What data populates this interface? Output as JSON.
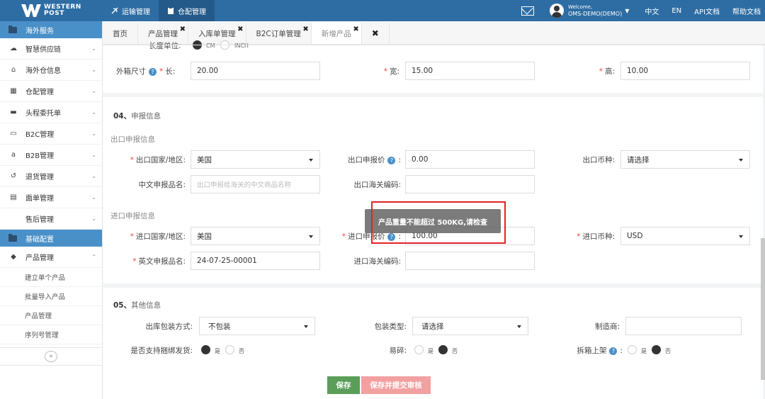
{
  "logo": {
    "line1": "WESTERN",
    "line2": "POST"
  },
  "topnav": [
    {
      "label": "运输管理",
      "icon": "plane-icon"
    },
    {
      "label": "仓配管理",
      "icon": "clipboard-icon"
    }
  ],
  "topright": {
    "welcome": "Welcome,",
    "user": "OMS-DEMO(DEMO)",
    "lang_zh": "中文",
    "lang_en": "EN",
    "api_docs": "API文档",
    "help_docs": "帮助文档"
  },
  "sidebar": {
    "section1": "海外服务",
    "items1": [
      {
        "label": "智慧供应链",
        "icon": "☁"
      },
      {
        "label": "海外仓信息",
        "icon": "⌂"
      },
      {
        "label": "仓配管理",
        "icon": "▦"
      },
      {
        "label": "头程委托单",
        "icon": "▬"
      },
      {
        "label": "B2C管理",
        "icon": "▭"
      },
      {
        "label": "B2B管理",
        "icon": "a"
      },
      {
        "label": "退货管理",
        "icon": "↺"
      },
      {
        "label": "面单管理",
        "icon": "▤"
      },
      {
        "label": "售后管理",
        "icon": ""
      }
    ],
    "section2": "基础配置",
    "product_mgmt": "产品管理",
    "subitems": [
      "建立单个产品",
      "批量导入产品",
      "产品管理",
      "序列号管理"
    ],
    "collapse": "«"
  },
  "tabs": [
    {
      "label": "首页",
      "closable": false
    },
    {
      "label": "产品管理",
      "closable": true
    },
    {
      "label": "入库单管理",
      "closable": true
    },
    {
      "label": "B2C订单管理",
      "closable": true
    },
    {
      "label": "新增产品",
      "closable": true
    }
  ],
  "form": {
    "unit": {
      "label": "长度单位:",
      "opt1": "CM",
      "opt2": "INCH"
    },
    "outer": {
      "label": "外箱尺寸",
      "length_label": "长:",
      "length": "20.00",
      "width_label": "宽:",
      "width": "15.00",
      "height_label": "高:",
      "height": "10.00"
    },
    "sec04": {
      "num": "04、",
      "title": "申报信息"
    },
    "export_title": "出口申报信息",
    "export": {
      "country_label": "出口国家/地区:",
      "country": "美国",
      "price_label": "出口申报价",
      "price": "0.00",
      "currency_label": "出口币种:",
      "currency": "请选择",
      "cn_name_label": "中文申报品名:",
      "cn_name_placeholder": "出口申报给海关的中文商品名称",
      "hs_label": "出口海关编码:"
    },
    "import_title": "进口申报信息",
    "import": {
      "country_label": "进口国家/地区:",
      "country": "美国",
      "price_label": "进口申报价",
      "price": "100.00",
      "currency_label": "进口币种:",
      "currency": "USD",
      "en_name_label": "英文申报品名:",
      "en_name": "24-07-25-00001",
      "hs_label": "进口海关编码:"
    },
    "sec05": {
      "num": "05、",
      "title": "其他信息"
    },
    "other": {
      "pack_label": "出库包装方式:",
      "pack": "不包装",
      "pack_type_label": "包装类型:",
      "pack_type": "请选择",
      "maker_label": "制造商:",
      "bundle_label": "是否支持捆绑发货:",
      "fragile_label": "易碎:",
      "unbox_label": "拆箱上架",
      "yes": "是",
      "no": "否"
    },
    "save": "保存",
    "save_submit": "保存并提交审核"
  },
  "toast": "产品重量不能超过 500KG,请检查",
  "colors": {
    "primary": "#2e6da4",
    "sidebar_section": "#4a90c8",
    "save": "#5a9e5a",
    "submit": "#f2a0a0",
    "highlight": "#e0242a"
  }
}
